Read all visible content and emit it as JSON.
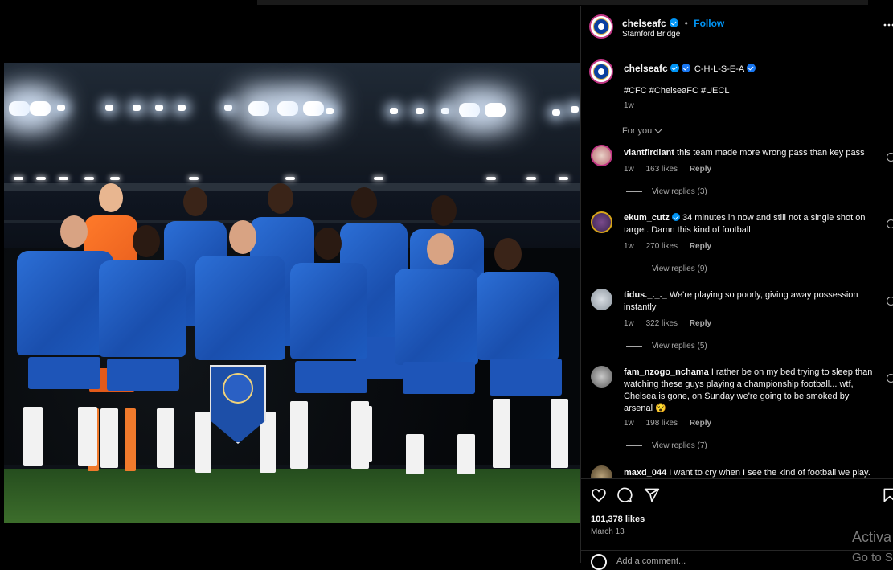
{
  "post": {
    "username": "chelseafc",
    "follow_label": "Follow",
    "separator": "•",
    "location": "Stamford Bridge",
    "caption_text": "C-H-L-S-E-A",
    "hashtags": "#CFC #ChelseaFC #UECL",
    "caption_age": "1w",
    "sort_label": "For you",
    "likes": "101,378 likes",
    "date": "March 13",
    "add_comment_placeholder": "Add a comment..."
  },
  "comments": [
    {
      "user": "viantfirdiant",
      "text": "this team made more wrong pass than key pass",
      "age": "1w",
      "likes": "163 likes",
      "reply": "Reply",
      "view_replies": "View replies (3)"
    },
    {
      "user": "ekum_cutz",
      "text": "34 minutes in now and still not a single shot on target. Damn this kind of football",
      "age": "1w",
      "likes": "270 likes",
      "reply": "Reply",
      "view_replies": "View replies (9)"
    },
    {
      "user": "tidus._._._",
      "text": "We're playing so poorly, giving away possession instantly",
      "age": "1w",
      "likes": "322 likes",
      "reply": "Reply",
      "view_replies": "View replies (5)"
    },
    {
      "user": "fam_nzogo_nchama",
      "text": "I rather be on my bed trying to sleep than watching these guys playing a championship football... wtf, Chelsea is gone, on Sunday we're going to be smoked by arsenal 😵",
      "age": "1w",
      "likes": "198 likes",
      "reply": "Reply",
      "view_replies": "View replies (7)"
    },
    {
      "user": "maxd_044",
      "text": "I want to cry when I see the kind of football we play."
    }
  ],
  "icons": {
    "more": "more-options-icon",
    "like": "heart-icon",
    "comment": "comment-icon",
    "share": "share-icon",
    "save": "bookmark-icon"
  },
  "watermark": {
    "line1": "Activa",
    "line2": "Go to S"
  },
  "colors": {
    "accent": "#0095f6",
    "shirt": "#1d5bc0",
    "keeper": "#ff7a2a"
  }
}
